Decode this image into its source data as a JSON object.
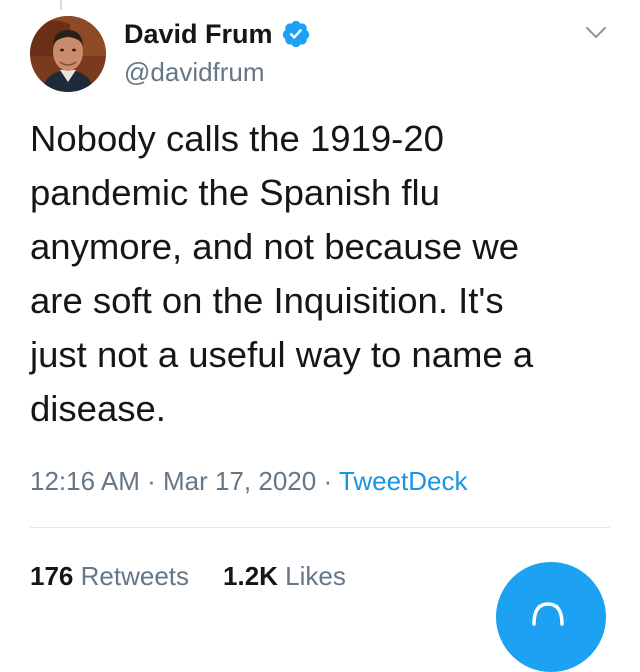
{
  "tweet": {
    "author": {
      "display_name": "David Frum",
      "handle": "@davidfrum",
      "verified": true,
      "avatar_icon": "profile-photo"
    },
    "text": "Nobody calls the 1919-20\npandemic the Spanish flu\nanymore, and not because we\nare soft on the Inquisition. It's\njust not a useful way to name a\ndisease.",
    "time": "12:16 AM",
    "separator": "·",
    "date": "Mar 17, 2020",
    "source": "TweetDeck",
    "stats": {
      "retweets_count": "176",
      "retweets_label": "Retweets",
      "likes_count": "1.2K",
      "likes_label": "Likes"
    }
  },
  "icons": {
    "verified": "verified-badge-icon",
    "menu": "chevron-down-icon",
    "compose": "compose-icon"
  },
  "colors": {
    "text_primary": "#14171a",
    "text_secondary": "#657786",
    "link": "#1b95e0",
    "brand_blue": "#1da1f2",
    "divider": "#e1e8ed"
  }
}
